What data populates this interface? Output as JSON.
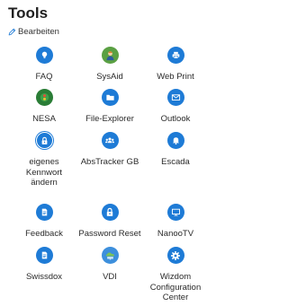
{
  "header": {
    "title": "Tools",
    "edit_label": "Bearbeiten"
  },
  "colors": {
    "accent": "#1e7bd6",
    "sysaid_bg": "#5aa043",
    "nesa_bg": "#2a7d36",
    "vdi_bg": "#3d8fdc"
  },
  "tiles": [
    {
      "label": "FAQ",
      "icon": "lightbulb-icon"
    },
    {
      "label": "SysAid",
      "icon": "user-avatar-icon"
    },
    {
      "label": "Web Print",
      "icon": "printer-icon"
    },
    {
      "label": "NESA",
      "icon": "nesa-logo-icon"
    },
    {
      "label": "File-Explorer",
      "icon": "folder-icon"
    },
    {
      "label": "Outlook",
      "icon": "envelope-icon"
    },
    {
      "label": "eigenes\nKennwort\nändern",
      "icon": "lock-icon"
    },
    {
      "label": "AbsTracker GB",
      "icon": "users-icon"
    },
    {
      "label": "Escada",
      "icon": "bell-icon"
    },
    {
      "label": "Feedback",
      "icon": "document-icon"
    },
    {
      "label": "Password Reset",
      "icon": "lock-icon"
    },
    {
      "label": "NanooTV",
      "icon": "monitor-icon"
    },
    {
      "label": "Swissdox",
      "icon": "document-icon"
    },
    {
      "label": "VDI",
      "icon": "cloud-display-icon"
    },
    {
      "label": "Wizdom\nConfiguration\nCenter",
      "icon": "gear-icon"
    }
  ]
}
